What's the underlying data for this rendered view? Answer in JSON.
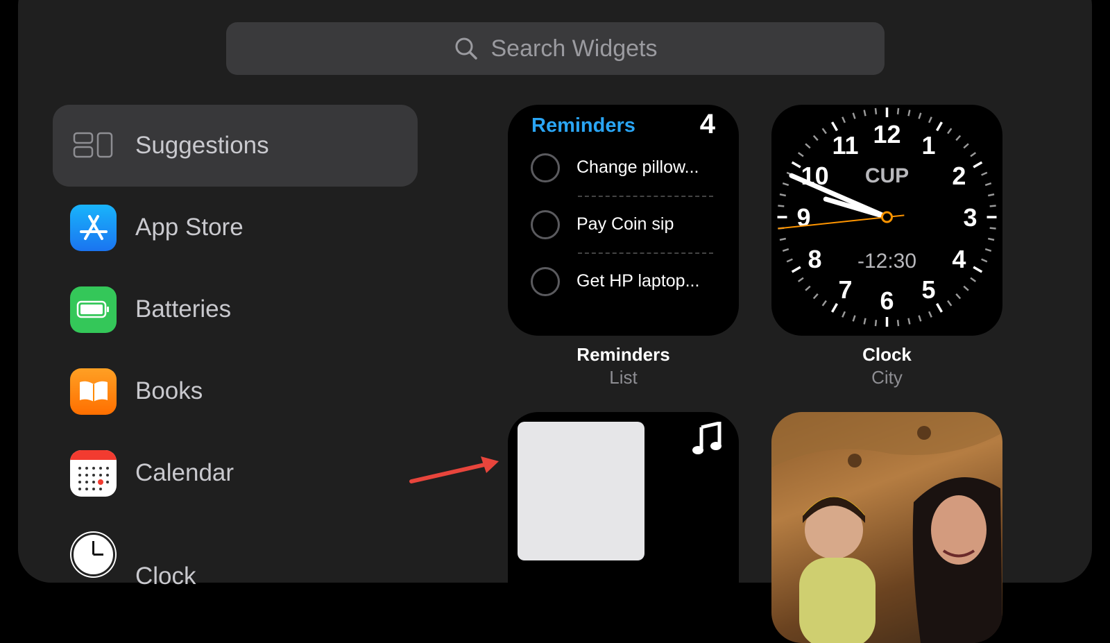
{
  "search": {
    "placeholder": "Search Widgets"
  },
  "sidebar": {
    "items": [
      {
        "label": "Suggestions",
        "icon": "suggestions-icon",
        "active": true
      },
      {
        "label": "App Store",
        "icon": "app-store-icon",
        "color": "#1a8cf5"
      },
      {
        "label": "Batteries",
        "icon": "battery-icon",
        "color": "#34c759"
      },
      {
        "label": "Books",
        "icon": "books-icon",
        "color": "#ff8a00"
      },
      {
        "label": "Calendar",
        "icon": "calendar-icon",
        "color": "#ffffff"
      },
      {
        "label": "Clock",
        "icon": "clock-icon"
      }
    ]
  },
  "widgets": {
    "reminders": {
      "title": "Reminders",
      "count": "4",
      "items": [
        "Change pillow...",
        "Pay Coin sip",
        "Get HP laptop..."
      ],
      "caption": "Reminders",
      "subcaption": "List",
      "accent": "#2aa5f4"
    },
    "clock": {
      "city": "CUP",
      "offset": "-12:30",
      "numerals": [
        "12",
        "1",
        "2",
        "3",
        "4",
        "5",
        "6",
        "7",
        "8",
        "9",
        "10",
        "11"
      ],
      "time": {
        "hour": 9,
        "minute": 47,
        "second": 44
      },
      "caption": "Clock",
      "subcaption": "City",
      "second_hand_color": "#ff9500"
    },
    "music": {
      "icon": "music-note-icon"
    },
    "photos": {
      "icon": "photo-thumbnail"
    }
  },
  "annotation": {
    "arrow_color": "#e8453c"
  }
}
